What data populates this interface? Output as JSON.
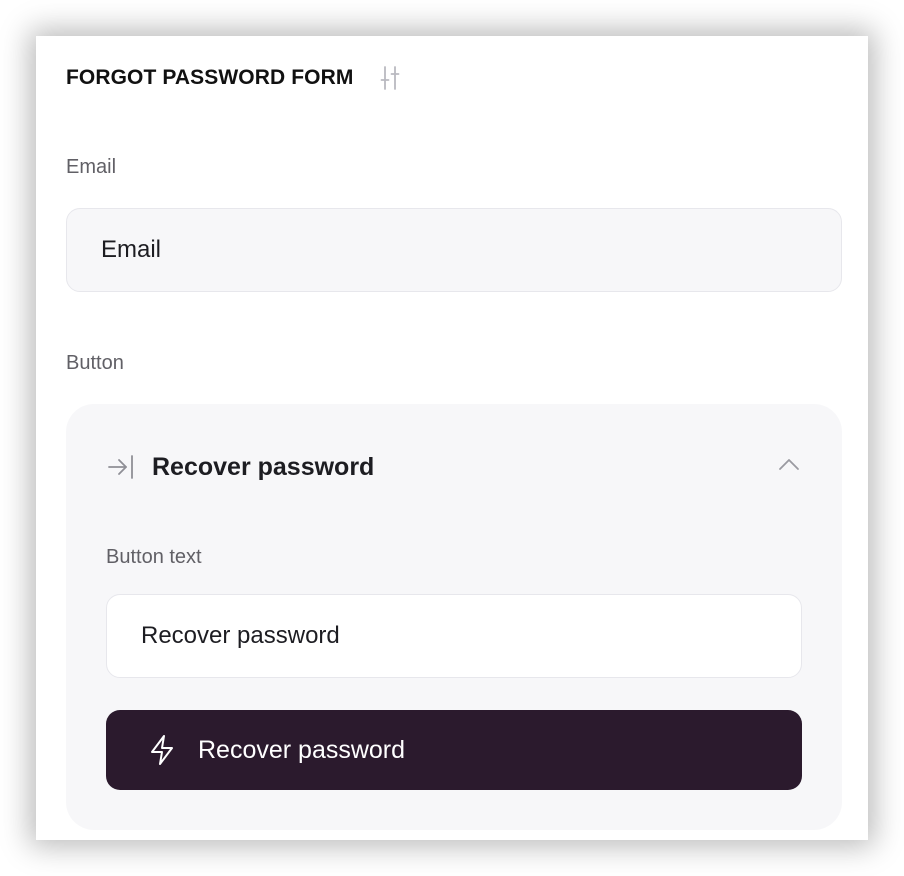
{
  "header": {
    "title": "FORGOT PASSWORD FORM",
    "settings_icon": "sliders-icon"
  },
  "email": {
    "label": "Email",
    "placeholder": "Email"
  },
  "button_section": {
    "label": "Button",
    "group_title": "Recover password",
    "group_icon": "arrow-right-to-line-icon",
    "collapse_icon": "chevron-up-icon",
    "text_field_label": "Button text",
    "text_field_value": "Recover password",
    "preview_label": "Recover password",
    "preview_icon": "lightning-icon"
  },
  "colors": {
    "primary_button": "#2b1a2d",
    "panel_bg": "#f7f7f9"
  }
}
